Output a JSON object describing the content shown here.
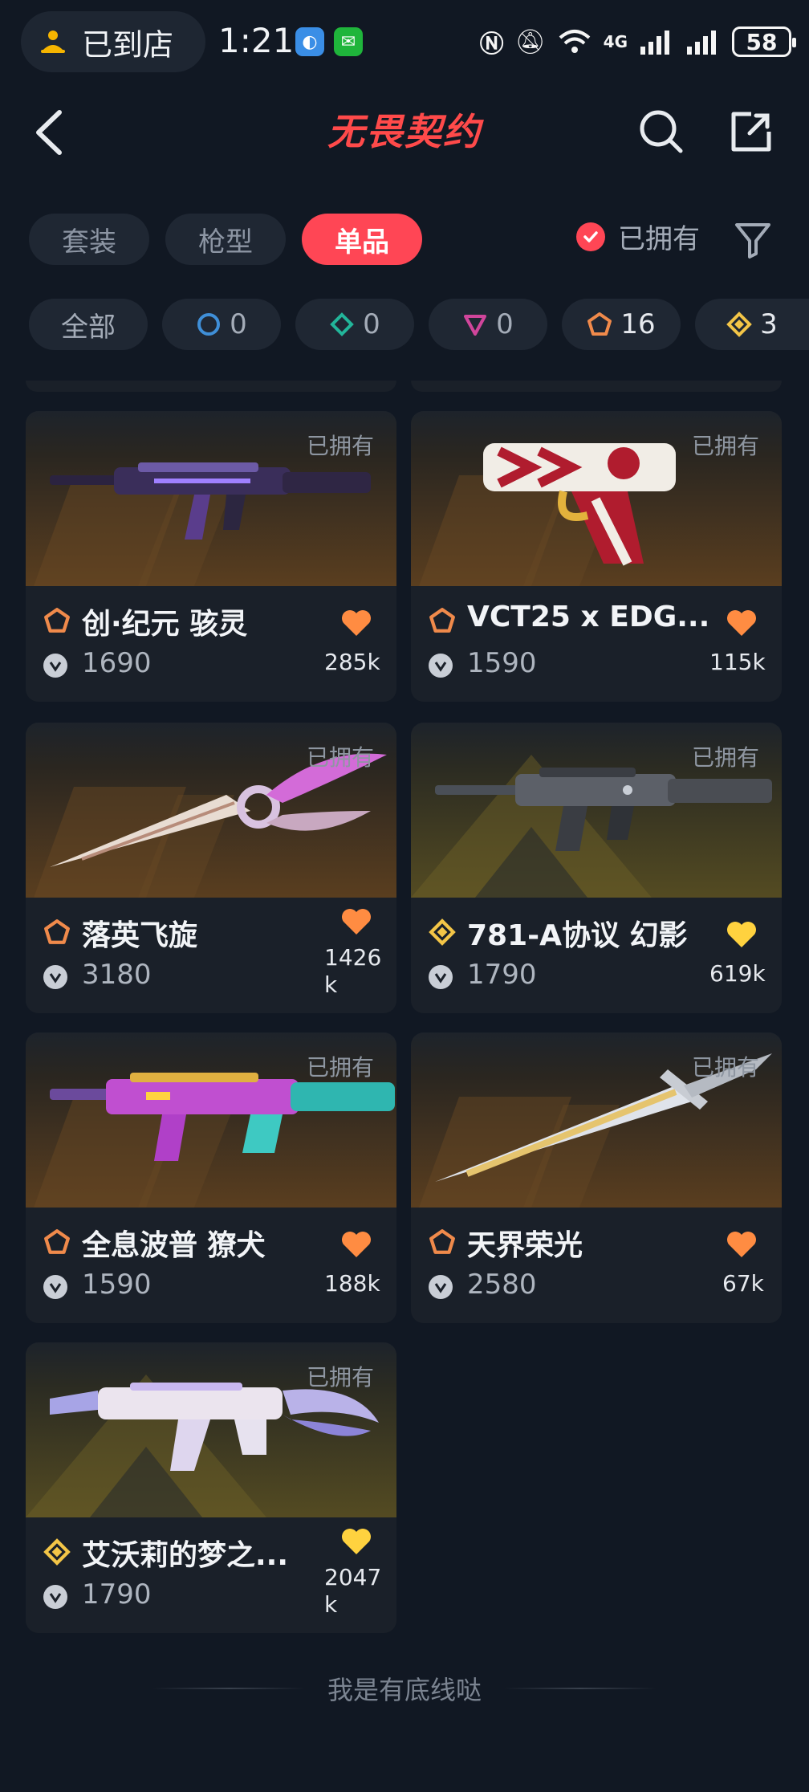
{
  "status_bar": {
    "store_label": "已到店",
    "time": "1:21",
    "network": "4G",
    "battery": "58"
  },
  "header": {
    "title": "无畏契约"
  },
  "tabs": [
    {
      "label": "套装",
      "active": false
    },
    {
      "label": "枪型",
      "active": false
    },
    {
      "label": "单品",
      "active": true
    }
  ],
  "owned_filter": {
    "label": "已拥有",
    "checked": true
  },
  "rarity_chips": [
    {
      "label": "全部",
      "icon": "all"
    },
    {
      "count": "0",
      "icon": "select-tier-icon",
      "color": "#3f8fd8"
    },
    {
      "count": "0",
      "icon": "deluxe-tier-icon",
      "color": "#22b59a"
    },
    {
      "count": "0",
      "icon": "premium-tier-icon",
      "color": "#d0459b"
    },
    {
      "count": "16",
      "icon": "ultra-tier-icon",
      "color": "#f08a4b"
    },
    {
      "count": "3",
      "icon": "exclusive-tier-icon",
      "color": "#f3c547"
    }
  ],
  "cards": [
    {
      "name": "创·纪元 骇灵",
      "price": "1690",
      "likes": "285k",
      "owned": "已拥有",
      "tier_color": "#f08a4b",
      "heart_color": "#ff8c42",
      "weapon": "smg-dark"
    },
    {
      "name": "VCT25 x EDG...",
      "price": "1590",
      "likes": "115k",
      "owned": "已拥有",
      "tier_color": "#f08a4b",
      "heart_color": "#ff8c42",
      "weapon": "pistol-edg"
    },
    {
      "name": "落英飞旋",
      "price": "3180",
      "likes": "1426\nk",
      "owned": "已拥有",
      "tier_color": "#f08a4b",
      "heart_color": "#ff8c42",
      "weapon": "knife-rose"
    },
    {
      "name": "781-A协议 幻影",
      "price": "1790",
      "likes": "619k",
      "owned": "已拥有",
      "tier_color": "#f3c547",
      "heart_color": "#ffd23f",
      "weapon": "rifle-grey"
    },
    {
      "name": "全息波普 獠犬",
      "price": "1590",
      "likes": "188k",
      "owned": "已拥有",
      "tier_color": "#f08a4b",
      "heart_color": "#ff8c42",
      "weapon": "rifle-holo"
    },
    {
      "name": "天界荣光",
      "price": "2580",
      "likes": "67k",
      "owned": "已拥有",
      "tier_color": "#f08a4b",
      "heart_color": "#ff8c42",
      "weapon": "sword-celestial"
    },
    {
      "name": "艾沃莉的梦之...",
      "price": "1790",
      "likes": "2047\nk",
      "owned": "已拥有",
      "tier_color": "#f3c547",
      "heart_color": "#ffd23f",
      "weapon": "smg-dream"
    }
  ],
  "footer": {
    "text": "我是有底线哒"
  }
}
